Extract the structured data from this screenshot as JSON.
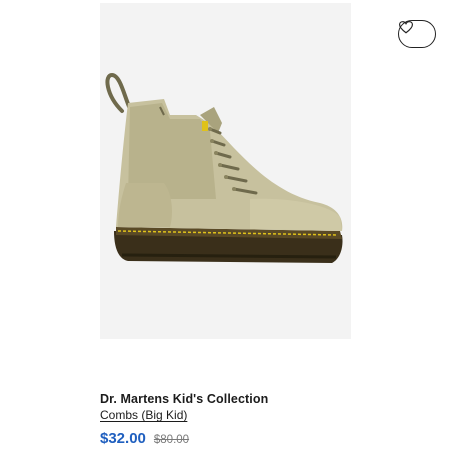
{
  "product": {
    "brand": "Dr. Martens Kid's Collection",
    "name": "Combs (Big Kid)",
    "sale_price": "$32.00",
    "original_price": "$80.00"
  },
  "wishlist": {
    "icon": "heart-icon"
  },
  "colors": {
    "sale_price": "#1f5fbf",
    "image_background": "#f3f3f3",
    "boot_upper": "#c7c19e",
    "boot_sole": "#3a2f1a",
    "welt_stitch": "#e0c21a"
  }
}
